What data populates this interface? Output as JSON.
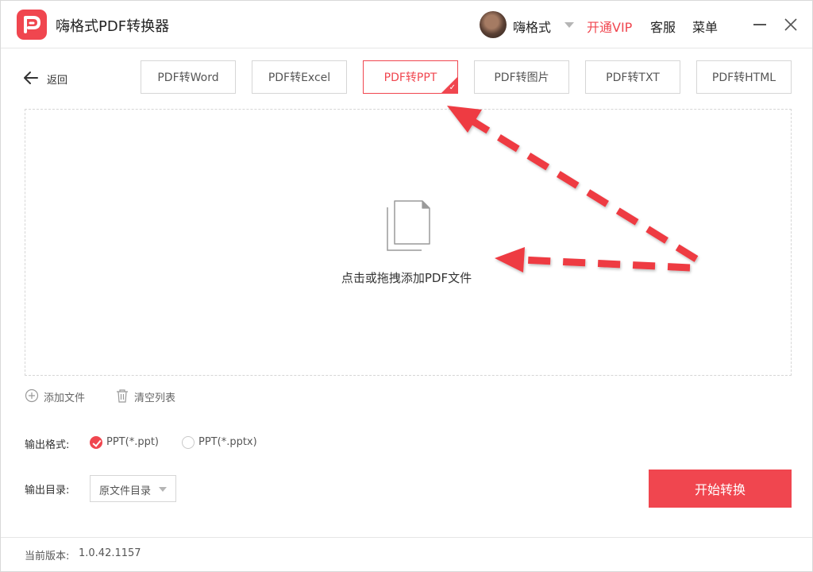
{
  "app": {
    "title": "嗨格式PDF转换器"
  },
  "header": {
    "username": "嗨格式",
    "vip_link": "开通VIP",
    "service_link": "客服",
    "menu_link": "菜单"
  },
  "nav": {
    "back_label": "返回",
    "tabs": [
      {
        "label": "PDF转Word"
      },
      {
        "label": "PDF转Excel"
      },
      {
        "label": "PDF转PPT",
        "active": true
      },
      {
        "label": "PDF转图片"
      },
      {
        "label": "PDF转TXT"
      },
      {
        "label": "PDF转HTML"
      }
    ]
  },
  "dropzone": {
    "hint": "点击或拖拽添加PDF文件"
  },
  "actions": {
    "add_file": "添加文件",
    "clear_list": "清空列表"
  },
  "output": {
    "format_label": "输出格式:",
    "formats": [
      {
        "label": "PPT(*.ppt)",
        "selected": true
      },
      {
        "label": "PPT(*.pptx)",
        "selected": false
      }
    ],
    "dir_label": "输出目录:",
    "dir_value": "原文件目录"
  },
  "start_button": "开始转换",
  "footer": {
    "version_label": "当前版本:",
    "version_value": "1.0.42.1157"
  },
  "colors": {
    "accent": "#f0464f",
    "border": "#d6d6d6",
    "text": "#333333"
  }
}
